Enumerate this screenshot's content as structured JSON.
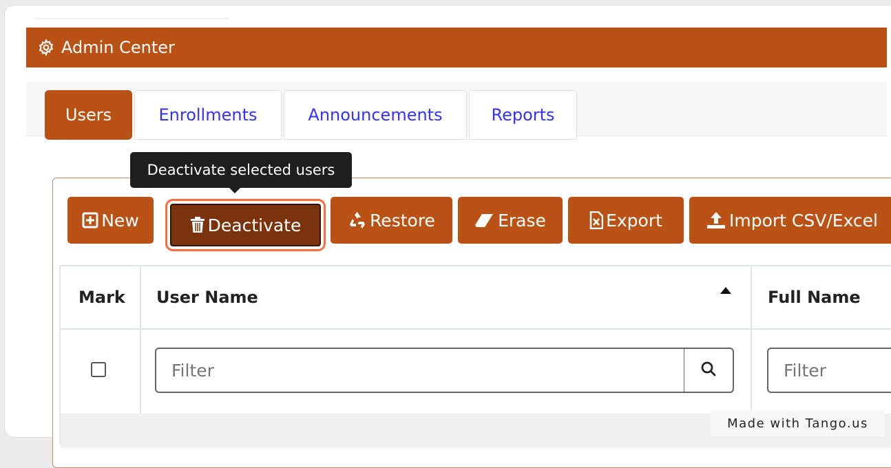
{
  "header": {
    "title": "Admin Center",
    "icon": "gear-icon"
  },
  "tabs": [
    {
      "label": "Users",
      "active": true
    },
    {
      "label": "Enrollments",
      "active": false
    },
    {
      "label": "Announcements",
      "active": false
    },
    {
      "label": "Reports",
      "active": false
    }
  ],
  "tooltip": {
    "text": "Deactivate selected users"
  },
  "toolbar": {
    "new_label": "New",
    "deactivate_label": "Deactivate",
    "restore_label": "Restore",
    "erase_label": "Erase",
    "export_label": "Export",
    "import_label": "Import CSV/Excel"
  },
  "table": {
    "columns": [
      "Mark",
      "User Name",
      "Full Name"
    ],
    "filter_placeholder": "Filter"
  },
  "watermark": {
    "text": "Made with Tango.us"
  },
  "colors": {
    "brand": "#b95214",
    "highlight": "#ff6b3d",
    "tab_link": "#3232ff"
  }
}
